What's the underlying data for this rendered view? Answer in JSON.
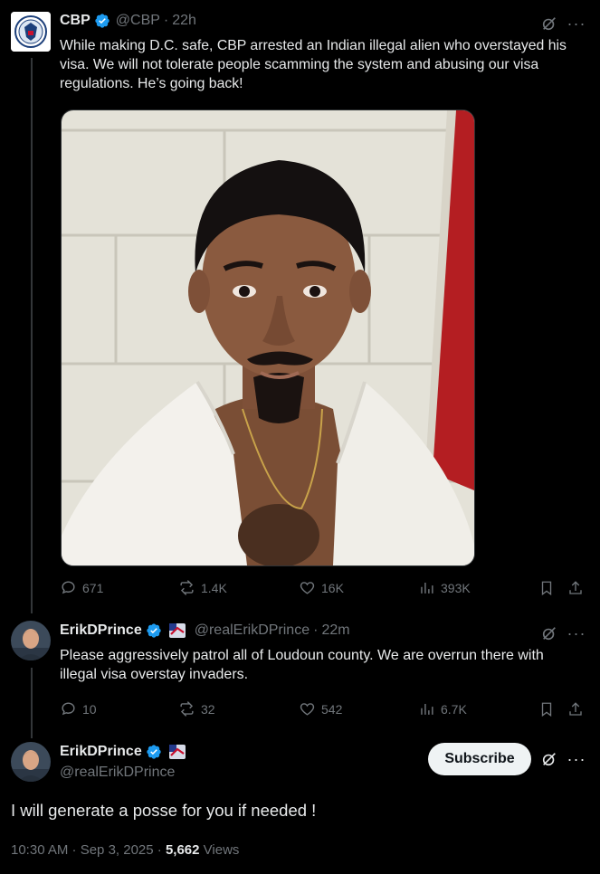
{
  "tweet1": {
    "display_name": "CBP",
    "handle": "@CBP",
    "separator": "·",
    "time": "22h",
    "text": "While making D.C. safe, CBP arrested an Indian illegal alien who overstayed his visa. We will not tolerate people scamming the system and abusing our visa regulations. He’s going back!",
    "media_icon": "photo-of-man-in-white-towel",
    "stats": {
      "replies": "671",
      "reposts": "1.4K",
      "likes": "16K",
      "views": "393K"
    }
  },
  "tweet2": {
    "display_name": "ErikDPrince",
    "handle": "@realErikDPrince",
    "separator": "·",
    "time": "22m",
    "text": "Please aggressively patrol all of Loudoun county. We are overrun there with illegal visa overstay invaders.",
    "stats": {
      "replies": "10",
      "reposts": "32",
      "likes": "542",
      "views": "6.7K"
    }
  },
  "main_tweet": {
    "display_name": "ErikDPrince",
    "handle": "@realErikDPrince",
    "subscribe_label": "Subscribe",
    "text": "I will generate a posse for you if needed !",
    "timestamp": "10:30 AM · Sep 3, 2025 · ",
    "views_count": "5,662",
    "views_label": " Views"
  },
  "colors": {
    "background": "#000000",
    "text": "#e7e9ea",
    "muted": "#71767b",
    "verified": "#1d9bf0",
    "thread_line": "#333639"
  },
  "icons": [
    "verified-badge-icon",
    "grok-icon",
    "more-icon",
    "reply-icon",
    "repost-icon",
    "like-icon",
    "views-icon",
    "bookmark-icon",
    "share-icon",
    "flag-badge-icon"
  ]
}
